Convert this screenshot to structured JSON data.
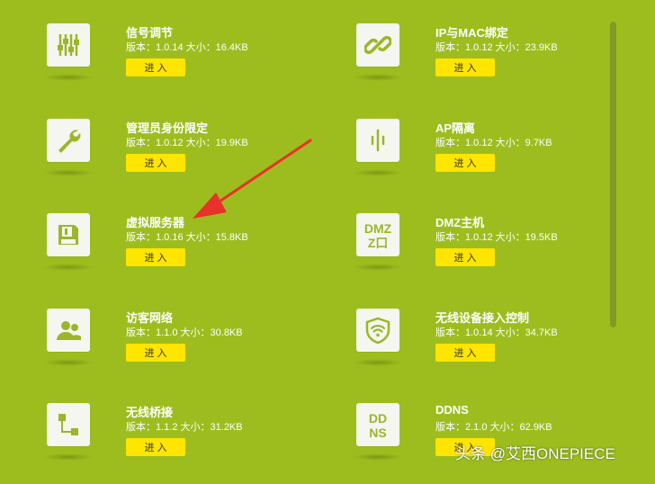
{
  "items": [
    {
      "title": "信号调节",
      "meta": "版本：1.0.14  大小：16.4KB",
      "button": "进 入",
      "icon": "sliders-icon"
    },
    {
      "title": "IP与MAC绑定",
      "meta": "版本：1.0.12  大小：23.9KB",
      "button": "进 入",
      "icon": "link-icon"
    },
    {
      "title": "管理员身份限定",
      "meta": "版本：1.0.12  大小：19.9KB",
      "button": "进 入",
      "icon": "wrench-icon"
    },
    {
      "title": "AP隔离",
      "meta": "版本：1.0.12  大小：9.7KB",
      "button": "进 入",
      "icon": "ap-isolation-icon"
    },
    {
      "title": "虚拟服务器",
      "meta": "版本：1.0.16  大小：15.8KB",
      "button": "进 入",
      "icon": "floppy-icon"
    },
    {
      "title": "DMZ主机",
      "meta": "版本：1.0.12  大小：19.5KB",
      "button": "进 入",
      "icon": "dmz-icon"
    },
    {
      "title": "访客网络",
      "meta": "版本：1.1.0  大小：30.8KB",
      "button": "进 入",
      "icon": "guests-icon"
    },
    {
      "title": "无线设备接入控制",
      "meta": "版本：1.0.14  大小：34.7KB",
      "button": "进 入",
      "icon": "wifi-shield-icon"
    },
    {
      "title": "无线桥接",
      "meta": "版本：1.1.2  大小：31.2KB",
      "button": "进 入",
      "icon": "bridge-icon"
    },
    {
      "title": "DDNS",
      "meta": "版本：2.1.0  大小：62.9KB",
      "button": "进 入",
      "icon": "ddns-icon"
    }
  ],
  "icon_text": {
    "dmz_top": "DMZ",
    "dmz_bottom": "Z口",
    "ddns_top": "DD",
    "ddns_bottom": "NS"
  },
  "watermark": "头条 @艾西ONEPIECE",
  "colors": {
    "background": "#9dbd1e",
    "button": "#ffe500",
    "icon": "#9db52a",
    "arrow": "#e8322a"
  }
}
